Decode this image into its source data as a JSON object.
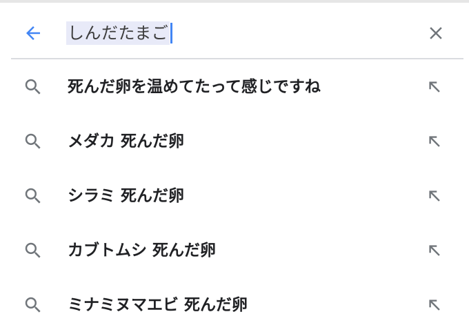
{
  "search": {
    "query": "しんだたまご"
  },
  "icons": {
    "back": "arrow-left-icon",
    "clear": "close-icon",
    "suggestion": "search-icon",
    "fill": "arrow-up-left-icon"
  },
  "colors": {
    "accent": "#4285f4",
    "icon_gray": "#70757a",
    "text": "#202124",
    "query_highlight": "#e8eaf8"
  },
  "suggestions": [
    {
      "label": "死んだ卵を温めてたって感じですね"
    },
    {
      "label": "メダカ 死んだ卵"
    },
    {
      "label": "シラミ 死んだ卵"
    },
    {
      "label": "カブトムシ 死んだ卵"
    },
    {
      "label": "ミナミヌマエビ 死んだ卵"
    }
  ]
}
